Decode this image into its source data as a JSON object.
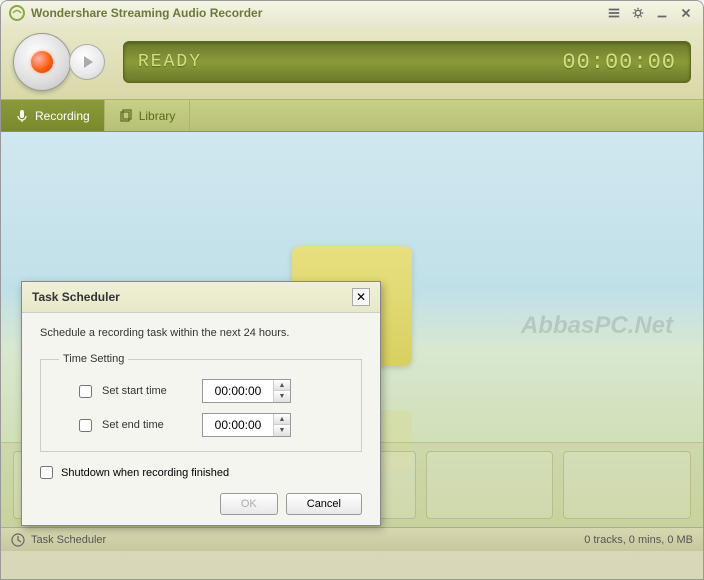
{
  "app": {
    "title": "Wondershare Streaming Audio Recorder"
  },
  "toolbar": {
    "status": "READY",
    "time": "00:00:00"
  },
  "tabs": {
    "recording": "Recording",
    "library": "Library"
  },
  "watermark": "AbbasPC.Net",
  "statusbar": {
    "left": "Task Scheduler",
    "right": "0 tracks, 0 mins, 0 MB"
  },
  "dialog": {
    "title": "Task Scheduler",
    "description": "Schedule a recording task within the next 24 hours.",
    "fieldset_label": "Time Setting",
    "start_label": "Set start time",
    "start_value": "00:00:00",
    "end_label": "Set end time",
    "end_value": "00:00:00",
    "shutdown_label": "Shutdown when recording finished",
    "ok": "OK",
    "cancel": "Cancel"
  }
}
